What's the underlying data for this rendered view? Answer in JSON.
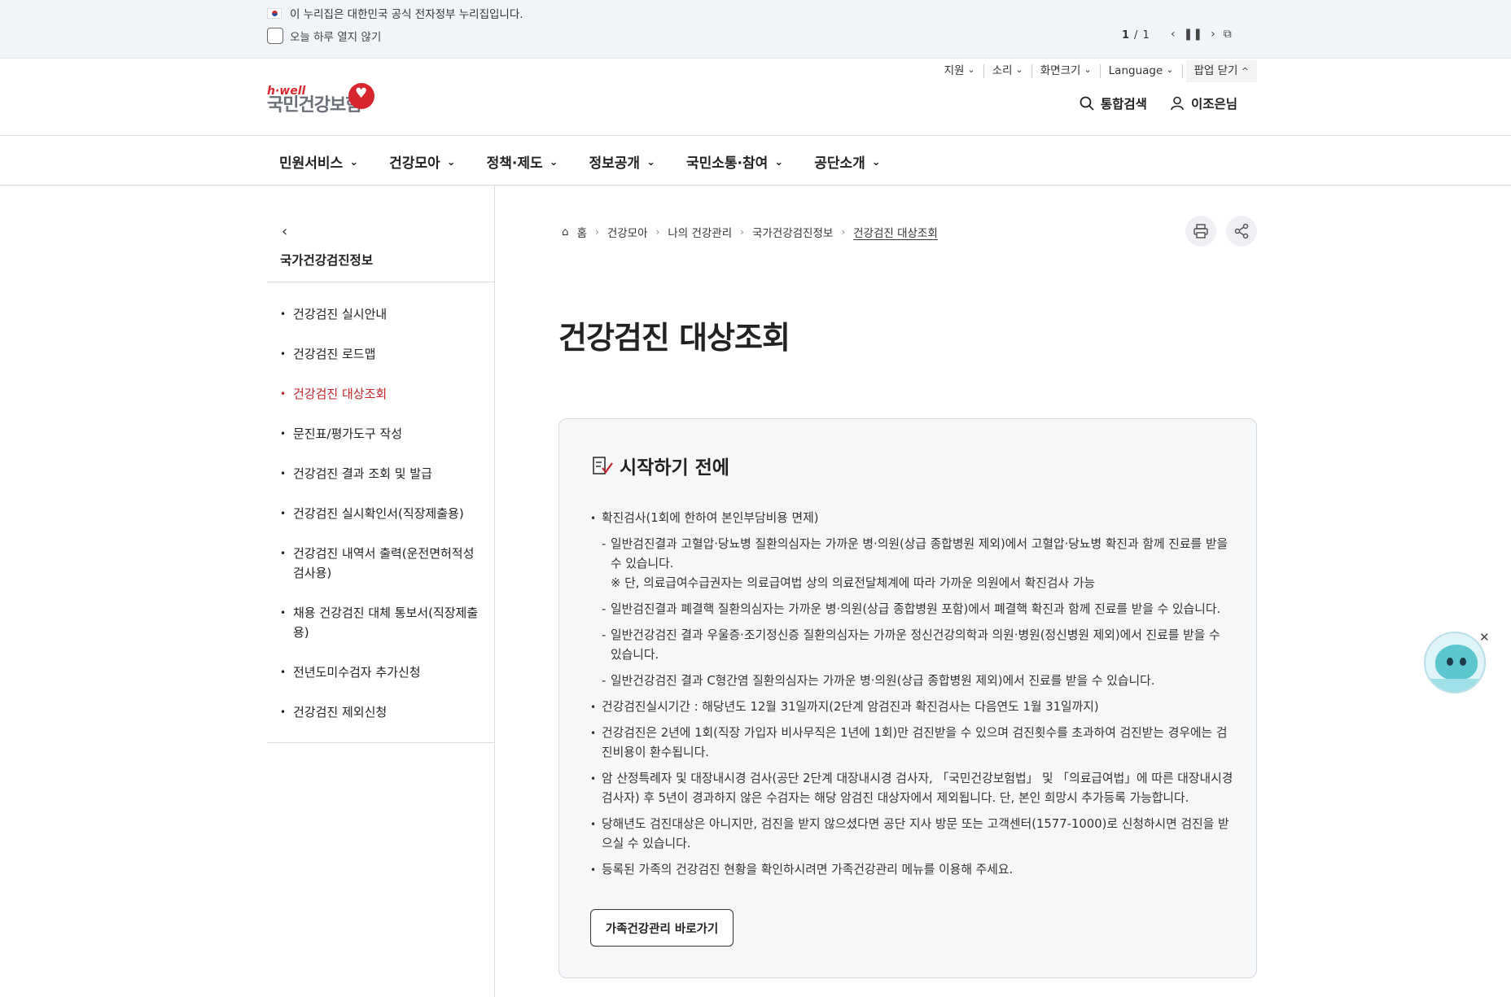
{
  "gov_banner": {
    "text": "이 누리집은 대한민국 공식 전자정부 누리집입니다.",
    "popup_checkbox_label": "오늘 하루 열지 않기",
    "pager_current": "1",
    "pager_sep": "/",
    "pager_total": "1"
  },
  "utility": {
    "support": "지원",
    "sound": "소리",
    "screen_size": "화면크기",
    "language": "Language",
    "close_popup": "팝업 닫기"
  },
  "header": {
    "logo_small": "h·well",
    "logo_name": "국민건강보험",
    "search": "통합검색",
    "user": "이조은님"
  },
  "gnb": [
    "민원서비스",
    "건강모아",
    "정책·제도",
    "정보공개",
    "국민소통·참여",
    "공단소개"
  ],
  "lnb": {
    "title": "국가건강검진정보",
    "items": [
      "건강검진 실시안내",
      "건강검진 로드맵",
      "건강검진 대상조회",
      "문진표/평가도구 작성",
      "건강검진 결과 조회 및 발급",
      "건강검진 실시확인서(직장제출용)",
      "건강검진 내역서 출력(운전면허적성검사용)",
      "채용 건강검진 대체 통보서(직장제출용)",
      "전년도미수검자 추가신청",
      "건강검진 제외신청"
    ],
    "active_index": 2
  },
  "breadcrumb": [
    "홈",
    "건강모아",
    "나의 건강관리",
    "국가건강검진정보",
    "건강검진 대상조회"
  ],
  "page_title": "건강검진 대상조회",
  "info_box": {
    "heading": "시작하기 전에",
    "confirm_test": "확진검사(1회에 한하여 본인부담비용 면제)",
    "sub": [
      "일반검진결과 고혈압·당뇨병 질환의심자는 가까운 병·의원(상급 종합병원 제외)에서 고혈압·당뇨병 확진과 함께 진료를 받을 수 있습니다.",
      "일반검진결과 폐결핵 질환의심자는 가까운 병·의원(상급 종합병원 포함)에서 폐결핵 확진과 함께 진료를 받을 수 있습니다.",
      "일반건강검진 결과 우울증·조기정신증 질환의심자는 가까운 정신건강의학과 의원·병원(정신병원 제외)에서 진료를 받을 수 있습니다.",
      "일반건강검진 결과 C형간염 질환의심자는 가까운 병·의원(상급 종합병원 제외)에서 진료를 받을 수 있습니다."
    ],
    "note": "※ 단, 의료급여수급권자는 의료급여법 상의 의료전달체계에 따라 가까운 의원에서 확진검사 가능",
    "bullets": [
      "건강검진실시기간 : 해당년도 12월 31일까지(2단계 암검진과 확진검사는 다음연도 1월 31일까지)",
      "건강검진은 2년에 1회(직장 가입자 비사무직은 1년에 1회)만 검진받을 수 있으며 검진횟수를 초과하여 검진받는 경우에는 검진비용이 환수됩니다.",
      "암 산정특례자 및 대장내시경 검사(공단 2단계 대장내시경 검사자, 「국민건강보험법」 및 「의료급여법」에 따른 대장내시경 검사자) 후 5년이 경과하지 않은 수검자는 해당 암검진 대상자에서 제외됩니다. 단, 본인 희망시 추가등록 가능합니다.",
      "당해년도 검진대상은 아니지만, 검진을 받지 않으셨다면 공단 지사 방문 또는 고객센터(1577-1000)로 신청하시면 검진을 받으실 수 있습니다.",
      "등록된 가족의 건강검진 현황을 확인하시려면 가족건강관리 메뉴를 이용해 주세요."
    ],
    "family_button": "가족건강관리 바로가기"
  },
  "chatbot": {
    "close": "✕"
  }
}
